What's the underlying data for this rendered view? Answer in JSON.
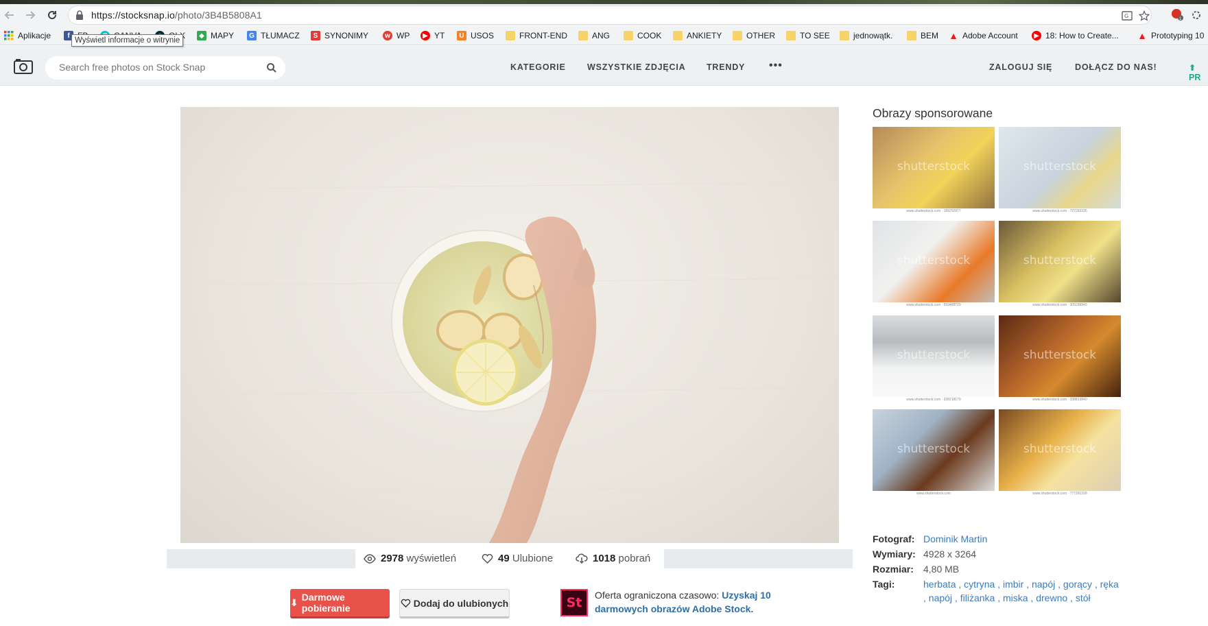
{
  "browser": {
    "url_host": "https://stocksnap.io",
    "url_path": "/photo/3B4B5808A1",
    "tooltip": "Wyświetl informacje o witrynie",
    "bookmarks": [
      {
        "label": "Aplikacje",
        "icon": "apps-grid-icon",
        "color": "#4285f4"
      },
      {
        "label": "FB",
        "icon": "facebook-icon",
        "color": "#3b5998"
      },
      {
        "label": "CANVA",
        "icon": "canva-icon",
        "color": "#00c4cc"
      },
      {
        "label": "OLX",
        "icon": "olx-icon",
        "color": "#002f34"
      },
      {
        "label": "MAPY",
        "icon": "maps-icon",
        "color": "#34a853"
      },
      {
        "label": "TŁUMACZ",
        "icon": "translate-icon",
        "color": "#4285f4"
      },
      {
        "label": "SYNONIMY",
        "icon": "synonimy-icon",
        "color": "#e53935"
      },
      {
        "label": "WP",
        "icon": "wp-icon",
        "color": "#e53935"
      },
      {
        "label": "YT",
        "icon": "youtube-icon",
        "color": "#ff0000"
      },
      {
        "label": "USOS",
        "icon": "usos-icon",
        "color": "#f58220"
      },
      {
        "label": "FRONT-END",
        "icon": "folder-icon",
        "color": "#f7d46a"
      },
      {
        "label": "ANG",
        "icon": "folder-icon",
        "color": "#f7d46a"
      },
      {
        "label": "COOK",
        "icon": "folder-icon",
        "color": "#f7d46a"
      },
      {
        "label": "ANKIETY",
        "icon": "folder-icon",
        "color": "#f7d46a"
      },
      {
        "label": "OTHER",
        "icon": "folder-icon",
        "color": "#f7d46a"
      },
      {
        "label": "TO SEE",
        "icon": "folder-icon",
        "color": "#f7d46a"
      },
      {
        "label": "jednowątk.",
        "icon": "folder-icon",
        "color": "#f7d46a"
      },
      {
        "label": "BEM",
        "icon": "folder-icon",
        "color": "#f7d46a"
      },
      {
        "label": "Adobe Account",
        "icon": "adobe-icon",
        "color": "#ed1c24"
      },
      {
        "label": "18: How to Create...",
        "icon": "youtube-icon",
        "color": "#ff0000"
      },
      {
        "label": "Prototyping 10",
        "icon": "adobe-icon",
        "color": "#ed1c24"
      }
    ]
  },
  "header": {
    "search_placeholder": "Search free photos on Stock Snap",
    "nav": [
      "KATEGORIE",
      "WSZYSTKIE ZDJĘCIA",
      "TRENDY"
    ],
    "more": "•••",
    "login": "ZALOGUJ SIĘ",
    "join": "DOŁĄCZ DO NAS!",
    "upload": "PR"
  },
  "stats": {
    "views_count": "2978",
    "views_label": "wyświetleń",
    "likes_count": "49",
    "likes_label": "Ulubione",
    "downloads_count": "1018",
    "downloads_label": "pobrań"
  },
  "actions": {
    "download_label": "Darmowe pobieranie",
    "favorite_label": "Dodaj do ulubionych",
    "adobe_logo_text": "St",
    "offer_text": "Oferta ograniczona czasowo: ",
    "offer_link": "Uzyskaj 10 darmowych obrazów Adobe Stock."
  },
  "sidebar": {
    "title": "Obrazy sponsorowane",
    "watermark": "shutterstock",
    "thumbs": [
      {
        "caption": "www.shutterstock.com · 189292877"
      },
      {
        "caption": "www.shutterstock.com · 727283335"
      },
      {
        "caption": "www.shutterstock.com · 559488729"
      },
      {
        "caption": "www.shutterstock.com · 305299943"
      },
      {
        "caption": "www.shutterstock.com · 328218179"
      },
      {
        "caption": "www.shutterstock.com · 338813840"
      },
      {
        "caption": "www.shutterstock.com"
      },
      {
        "caption": "www.shutterstock.com · 777391318"
      }
    ]
  },
  "meta": {
    "photographer_label": "Fotograf:",
    "photographer": "Dominik Martin",
    "dimensions_label": "Wymiary:",
    "dimensions": "4928 x 3264",
    "size_label": "Rozmiar:",
    "size": "4,80 MB",
    "tags_label": "Tagi:",
    "tags": [
      "herbata",
      "cytryna",
      "imbir",
      "napój",
      "gorący",
      "ręka",
      "napój",
      "filiżanka",
      "miska",
      "drewno",
      "stół"
    ]
  }
}
